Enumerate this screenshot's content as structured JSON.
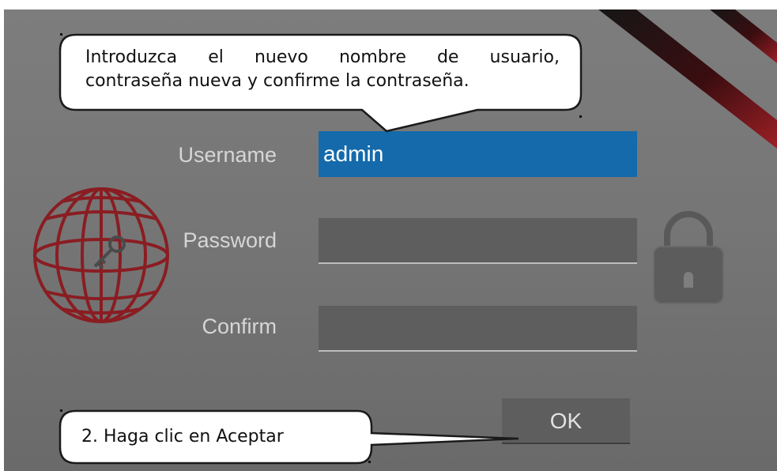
{
  "form": {
    "username_label": "Username",
    "username_value": "admin",
    "password_label": "Password",
    "password_value": "",
    "confirm_label": "Confirm",
    "confirm_value": "",
    "ok_label": "OK"
  },
  "callouts": {
    "top_line1": "Introduzca el nuevo nombre de usuario,",
    "top_line2": "contraseña nueva y confirme la contraseña.",
    "bottom": "2. Haga clic en Aceptar"
  },
  "colors": {
    "panel": "#767676",
    "selected_field": "#146aaa",
    "field": "#5e5e5e",
    "globe": "#8a1d22"
  },
  "icons": [
    "globe-key-icon",
    "padlock-icon"
  ]
}
